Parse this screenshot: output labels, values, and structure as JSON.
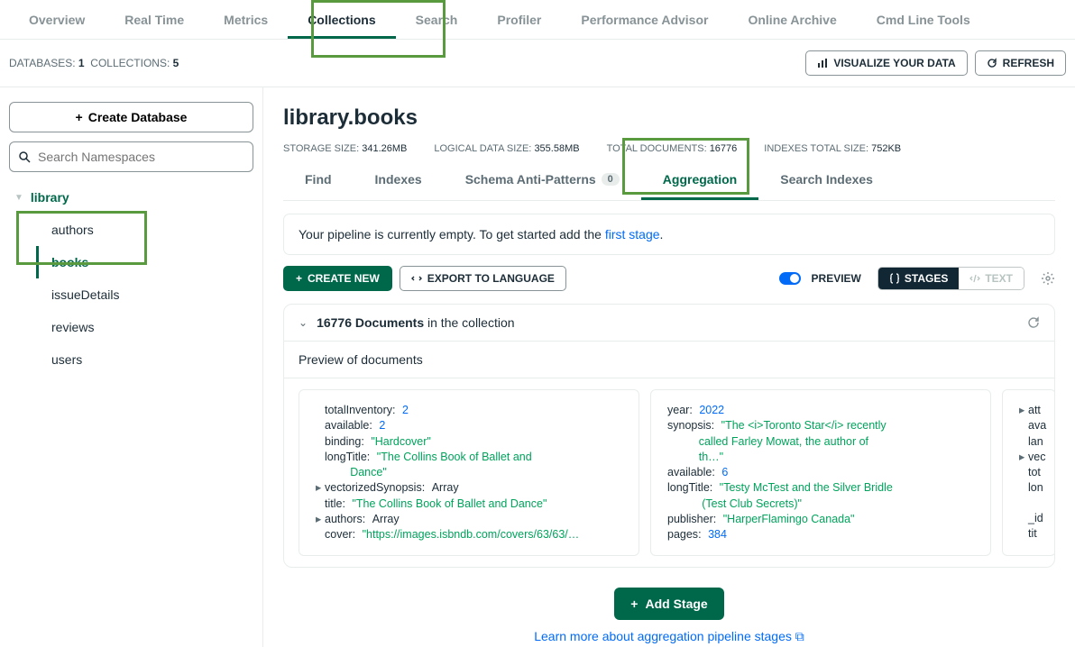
{
  "topTabs": {
    "overview": "Overview",
    "realtime": "Real Time",
    "metrics": "Metrics",
    "collections": "Collections",
    "search": "Search",
    "profiler": "Profiler",
    "perf": "Performance Advisor",
    "archive": "Online Archive",
    "cmd": "Cmd Line Tools"
  },
  "infoBar": {
    "dbLabel": "DATABASES:",
    "dbCount": "1",
    "collLabel": "COLLECTIONS:",
    "collCount": "5",
    "visualize": "VISUALIZE YOUR DATA",
    "refresh": "REFRESH"
  },
  "sidebar": {
    "createDb": "Create Database",
    "searchPlaceholder": "Search Namespaces",
    "db": "library",
    "items": [
      "authors",
      "books",
      "issueDetails",
      "reviews",
      "users"
    ]
  },
  "header": {
    "title": "library.books",
    "stats": {
      "storageLbl": "STORAGE SIZE:",
      "storageVal": "341.26MB",
      "logicalLbl": "LOGICAL DATA SIZE:",
      "logicalVal": "355.58MB",
      "totalDocsLbl": "TOTAL DOCUMENTS:",
      "totalDocsVal": "16776",
      "idxLbl": "INDEXES TOTAL SIZE:",
      "idxVal": "752KB"
    }
  },
  "subTabs": {
    "find": "Find",
    "indexes": "Indexes",
    "schema": "Schema Anti-Patterns",
    "schemaBadge": "0",
    "aggregation": "Aggregation",
    "searchIdx": "Search Indexes"
  },
  "emptyBar": {
    "text": "Your pipeline is currently empty. To get started add the ",
    "link": "first stage",
    "dot": "."
  },
  "toolbar": {
    "createNew": "CREATE NEW",
    "export": "EXPORT TO LANGUAGE",
    "preview": "PREVIEW",
    "stages": "STAGES",
    "text": "TEXT"
  },
  "panel": {
    "count": "16776 Documents",
    "suffix": " in the collection",
    "previewLbl": "Preview of documents"
  },
  "doc1": {
    "l1k": "totalInventory",
    "l1v": "2",
    "l2k": "available",
    "l2v": "2",
    "l3k": "binding",
    "l3v": "\"Hardcover\"",
    "l4k": "longTitle",
    "l4v": "\"The Collins Book of Ballet and",
    "l4c": "           Dance\"",
    "l5k": "vectorizedSynopsis",
    "l5v": "Array",
    "l6k": "title",
    "l6v": "\"The Collins Book of Ballet and Dance\"",
    "l7k": "authors",
    "l7v": "Array",
    "l8k": "cover",
    "l8v": "\"https://images.isbndb.com/covers/63/63/…"
  },
  "doc2": {
    "l1k": "year",
    "l1v": "2022",
    "l2k": "synopsis",
    "l2v": "\"The <i>Toronto Star</i> recently",
    "l2c1": "          called Farley Mowat, the author of",
    "l2c2": "          th…\"",
    "l3k": "available",
    "l3v": "6",
    "l4k": "longTitle",
    "l4v": "\"Testy McTest and the Silver Bridle",
    "l4c": "           (Test Club Secrets)\"",
    "l5k": "publisher",
    "l5v": "\"HarperFlamingo Canada\"",
    "l6k": "pages",
    "l6v": "384"
  },
  "doc3": {
    "l1": "att",
    "l2": "ava",
    "l3": "lan",
    "l4": "vec",
    "l5": "tot",
    "l6": "lon",
    "l7": "_id",
    "l8": "tit"
  },
  "footer": {
    "addStage": "Add Stage",
    "learn": "Learn more about aggregation pipeline stages"
  }
}
